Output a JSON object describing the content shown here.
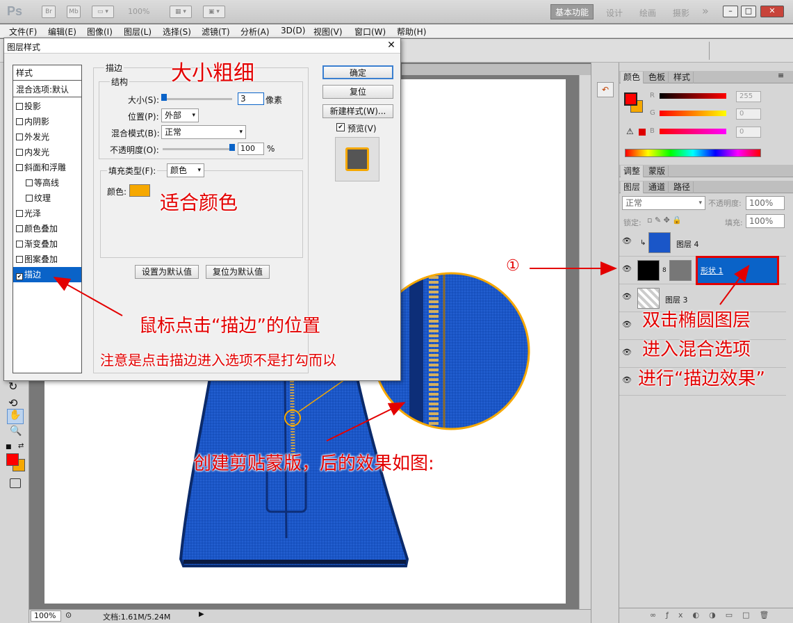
{
  "app": {
    "logo": "Ps",
    "bridge": "Br",
    "minibridge": "Mb",
    "zoom": "100%",
    "workspaces": [
      "基本功能",
      "设计",
      "绘画",
      "摄影"
    ],
    "more": "»"
  },
  "menu": [
    "文件(F)",
    "编辑(E)",
    "图像(I)",
    "图层(L)",
    "选择(S)",
    "滤镜(T)",
    "分析(A)",
    "3D(D)",
    "视图(V)",
    "窗口(W)",
    "帮助(H)"
  ],
  "dialog": {
    "title": "图层样式",
    "close": "✕",
    "styles_header": "样式",
    "blend_options": "混合选项:默认",
    "effects": [
      "投影",
      "内阴影",
      "外发光",
      "内发光",
      "斜面和浮雕",
      "等高线",
      "纹理",
      "光泽",
      "颜色叠加",
      "渐变叠加",
      "图案叠加",
      "描边"
    ],
    "selected_effect": "描边",
    "stroke": {
      "section": "描边",
      "structure": "结构",
      "size_label": "大小(S):",
      "size_value": "3",
      "size_unit": "像素",
      "position_label": "位置(P):",
      "position_value": "外部",
      "blend_label": "混合模式(B):",
      "blend_value": "正常",
      "opacity_label": "不透明度(O):",
      "opacity_value": "100",
      "opacity_unit": "%",
      "fill_type_label": "填充类型(F):",
      "fill_type_value": "颜色",
      "color_label": "颜色:",
      "color": "#f6a800",
      "set_default": "设置为默认值",
      "reset_default": "复位为默认值"
    },
    "buttons": {
      "ok": "确定",
      "reset": "复位",
      "new_style": "新建样式(W)...",
      "preview": "预览(V)"
    }
  },
  "panels": {
    "color_tabs": [
      "颜色",
      "色板",
      "样式"
    ],
    "color": {
      "fg": "#ff0000",
      "bg": "#f6a800",
      "r_label": "R",
      "r_value": "255",
      "g_label": "G",
      "g_value": "0",
      "b_label": "B",
      "b_value": "0"
    },
    "adjust_tabs": [
      "调整",
      "蒙版"
    ],
    "layer_tabs": [
      "图层",
      "通道",
      "路径"
    ],
    "blend_mode": "正常",
    "opacity_label": "不透明度:",
    "opacity_value": "100%",
    "lock_label": "锁定:",
    "fill_label": "填充:",
    "fill_value": "100%",
    "layers": [
      {
        "name": "图层 4"
      },
      {
        "name": "形状 1"
      },
      {
        "name": "图层 3"
      }
    ]
  },
  "status": {
    "zoom": "100%",
    "doc": "文档:1.61M/5.24M"
  },
  "annotations": {
    "size": "大小粗细",
    "color": "适合颜色",
    "click_stroke": "鼠标点击“描边”的位置",
    "note": "注意是点击描边进入选项不是打勾而以",
    "step": "①",
    "dblclick_1": "双击椭圆图层",
    "dblclick_2": "进入混合选项",
    "dblclick_3": "进行“描边效果”",
    "clip": "创建剪贴蒙版，后的效果如图:"
  },
  "colors": {
    "bag": "#1a56c8",
    "accent_red": "#e30000",
    "selection": "#0a63c8"
  }
}
